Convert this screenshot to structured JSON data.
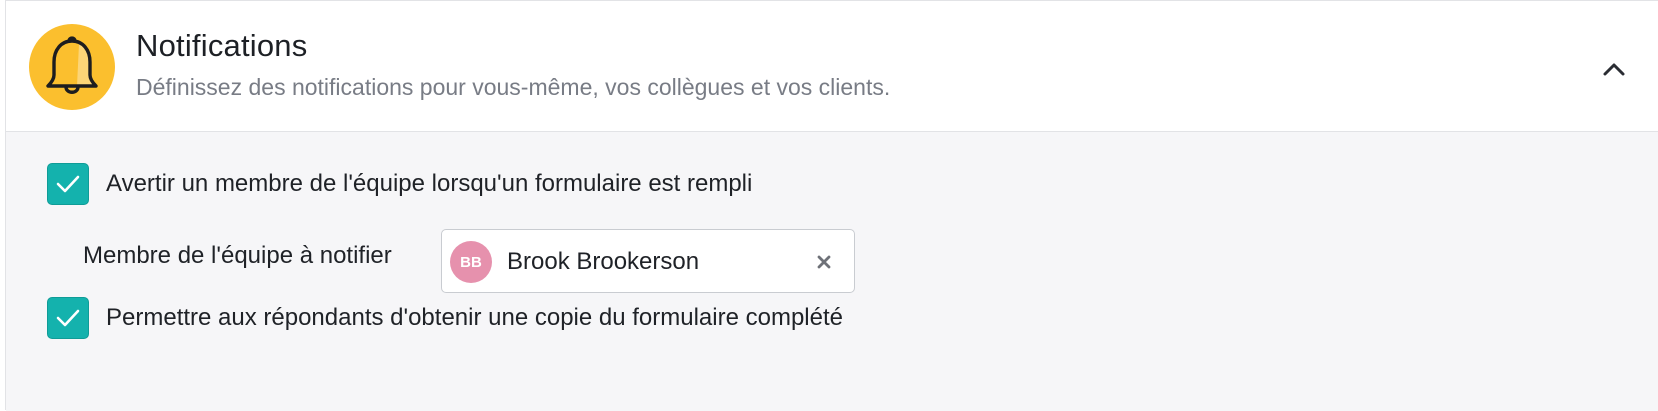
{
  "header": {
    "title": "Notifications",
    "subtitle": "Définissez des notifications pour vous-même, vos collègues et vos clients.",
    "icon": "bell-icon",
    "icon_bg_color": "#fbbf2e",
    "collapse_icon": "chevron-up-icon"
  },
  "settings": {
    "notify_team": {
      "checked": true,
      "label": "Avertir un membre de l'équipe lorsqu'un formulaire est rempli"
    },
    "team_member": {
      "label": "Membre de l'équipe à notifier",
      "selected": {
        "initials": "BB",
        "name": "Brook Brookerson",
        "avatar_color": "#e691ad"
      },
      "clear_icon": "close-icon"
    },
    "respondent_copy": {
      "checked": true,
      "label": "Permettre aux répondants d'obtenir une copie du formulaire complété"
    },
    "accent_color": "#14b2ad"
  }
}
